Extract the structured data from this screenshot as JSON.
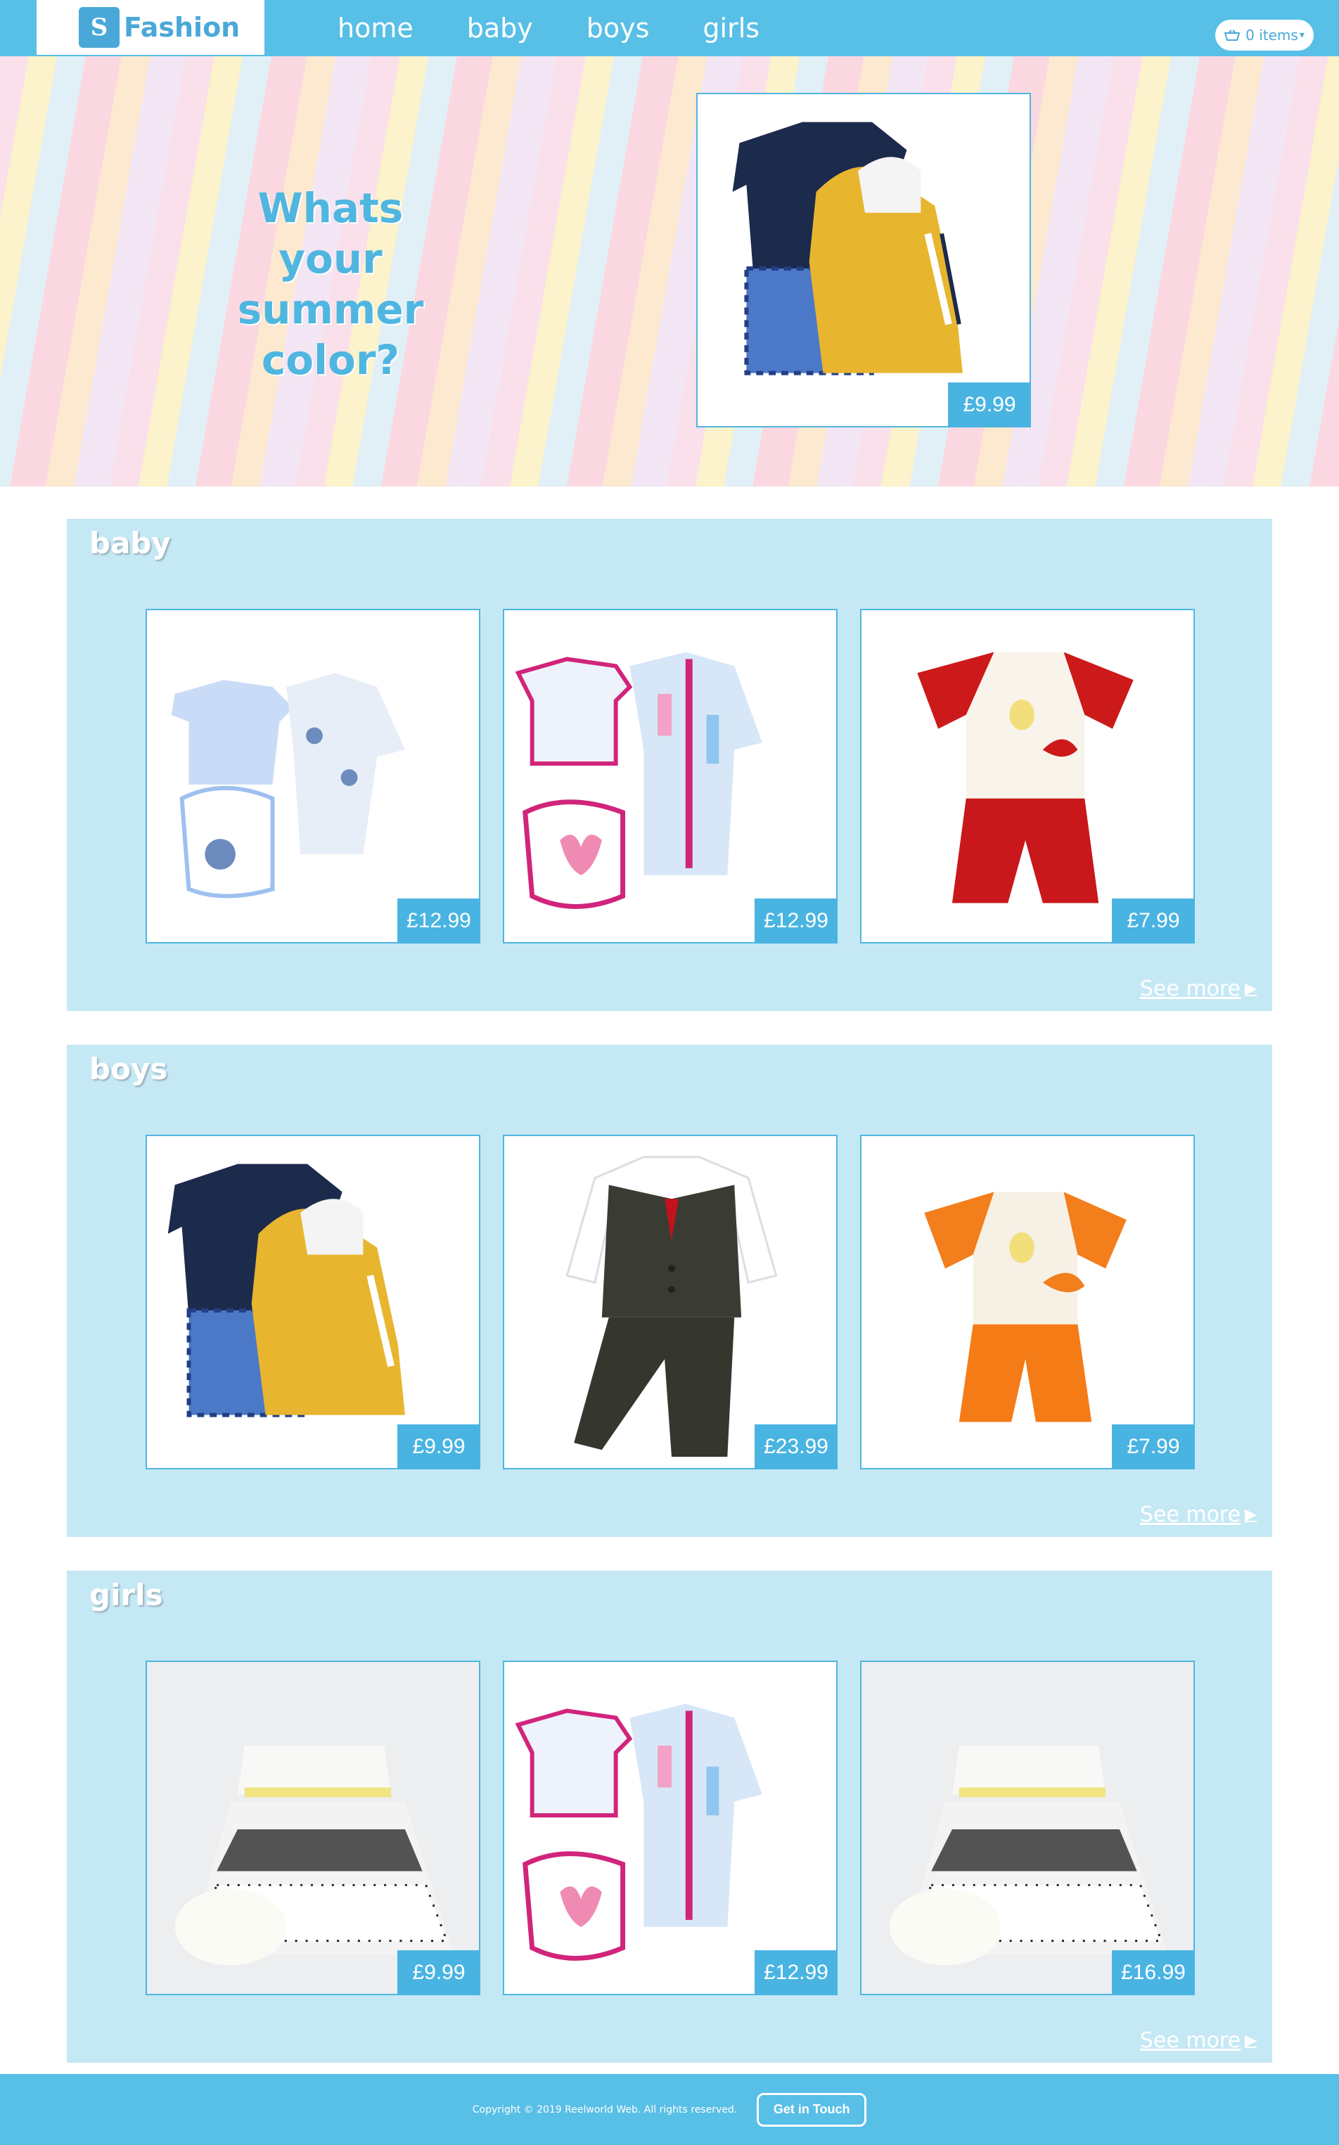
{
  "brand": {
    "name": "Fashion",
    "logo_icon": "logo-mark"
  },
  "nav": {
    "links": [
      "home",
      "baby",
      "boys",
      "girls"
    ],
    "cart_label": "0 items",
    "cart_icon": "basket-icon"
  },
  "hero": {
    "headline": "Whats your summer color?",
    "price": "£9.99"
  },
  "sections": [
    {
      "title": "baby",
      "see_more": "See more",
      "products": [
        {
          "price": "£12.99",
          "kind": "blue-bodysuit-set"
        },
        {
          "price": "£12.99",
          "kind": "pink-bodysuit-set"
        },
        {
          "price": "£7.99",
          "kind": "red-shirt-shorts"
        }
      ]
    },
    {
      "title": "boys",
      "see_more": "See more",
      "products": [
        {
          "price": "£9.99",
          "kind": "navy-yellow-jacket-set"
        },
        {
          "price": "£23.99",
          "kind": "tweed-waistcoat-suit"
        },
        {
          "price": "£7.99",
          "kind": "orange-shirt-shorts"
        }
      ]
    },
    {
      "title": "girls",
      "see_more": "See more",
      "products": [
        {
          "price": "£9.99",
          "kind": "polka-dot-dress"
        },
        {
          "price": "£12.99",
          "kind": "pink-bodysuit-set"
        },
        {
          "price": "£16.99",
          "kind": "polka-dot-dress"
        }
      ]
    }
  ],
  "footer": {
    "copyright": "Copyright © 2019 Reelworld Web. All rights reserved.",
    "cta": "Get in Touch"
  },
  "colors": {
    "accent": "#58bfe6",
    "section_bg": "#c5e8f5",
    "price_bg": "#49b4e2"
  }
}
